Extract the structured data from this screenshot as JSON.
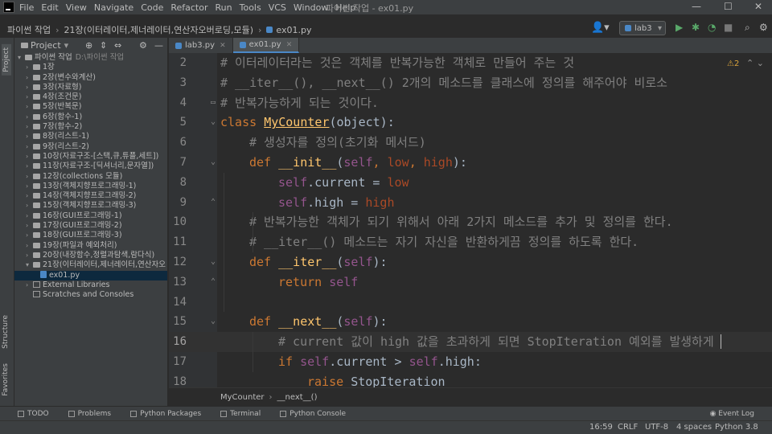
{
  "menubar": {
    "items": [
      "File",
      "Edit",
      "View",
      "Navigate",
      "Code",
      "Refactor",
      "Run",
      "Tools",
      "VCS",
      "Window",
      "Help"
    ],
    "window_title": "파이썬 작업 - ex01.py"
  },
  "navbar": {
    "project": "파이썬 작업",
    "folder": "21장(이터레이터,제너레이터,연산자오버로딩,모듈)",
    "file": "ex01.py",
    "run_config": "lab3"
  },
  "left_strip": {
    "project": "Project",
    "structure": "Structure",
    "favorites": "Favorites"
  },
  "project_panel": {
    "title": "Project",
    "root": "파이썬 작업",
    "root_path": "D:\\파이썬 작업",
    "folders": [
      "1장",
      "2장(변수와계산)",
      "3장(자료형)",
      "4장(조건문)",
      "5장(반복문)",
      "6장(함수-1)",
      "7장(함수-2)",
      "8장(리스트-1)",
      "9장(리스트-2)",
      "10장(자료구조-[스택,큐,튜플,세트])",
      "11장(자료구조-[딕셔너리,문자열])",
      "12장(collections 모듈)",
      "13장(객체지향프로그래밍-1)",
      "14장(객체지향프로그래밍-2)",
      "15장(객체지향프로그래밍-3)",
      "16장(GUI프로그래밍-1)",
      "17장(GUI프로그래밍-2)",
      "18장(GUI프로그래밍-3)",
      "19장(파일과 예외처리)",
      "20장(내장함수,정렬과탐색,람다식)",
      "21장(이터레이터,제너레이터,연산자오"
    ],
    "selected_file": "ex01.py",
    "external_libraries": "External Libraries",
    "scratches": "Scratches and Consoles"
  },
  "editor_tabs": [
    "lab3.py",
    "ex01.py"
  ],
  "editor": {
    "inspection_count": "2",
    "lines": [
      {
        "num": "2",
        "text": "# 이터레이터라는 것은 객체를 반복가능한 객체로 만들어 주는 것"
      },
      {
        "num": "3",
        "text": "# __iter__(), __next__() 2개의 메소드를 클래스에 정의를 해주어야 비로소"
      },
      {
        "num": "4",
        "text": "# 반복가능하게 되는 것이다."
      },
      {
        "num": "5",
        "kw": "class",
        "name": "MyCounter",
        "rest": "(object):"
      },
      {
        "num": "6",
        "text": "# 생성자를 정의(초기화 메서드)"
      },
      {
        "num": "7",
        "kw": "def",
        "fn": "__init__",
        "p_self": "self",
        "p1": "low",
        "p2": "high"
      },
      {
        "num": "8",
        "self": "self",
        "attr": ".current = ",
        "val": "low"
      },
      {
        "num": "9",
        "self": "self",
        "attr": ".high = ",
        "val": "high"
      },
      {
        "num": "10",
        "text": "# 반복가능한 객체가 되기 위해서 아래 2가지 메소드를 추가 및 정의를 한다."
      },
      {
        "num": "11",
        "text": "# __iter__() 메소드는 자기 자신을 반환하게끔 정의를 하도록 한다."
      },
      {
        "num": "12",
        "kw": "def",
        "fn": "__iter__",
        "p_self": "self"
      },
      {
        "num": "13",
        "kw": "return",
        "self": "self"
      },
      {
        "num": "14"
      },
      {
        "num": "15",
        "kw": "def",
        "fn": "__next__",
        "p_self": "self"
      },
      {
        "num": "16",
        "text": "# current 값이 high 값을 초과하게 되면 StopIteration 예외를 발생하게"
      },
      {
        "num": "17",
        "kw": "if",
        "self1": "self",
        "mid": ".current > ",
        "self2": "self",
        "end": ".high:"
      },
      {
        "num": "18",
        "kw": "raise",
        "exc": "StopIteration"
      }
    ]
  },
  "editor_breadcrumb": {
    "class": "MyCounter",
    "method": "__next__()"
  },
  "tool_windows": [
    "TODO",
    "Problems",
    "Python Packages",
    "Terminal",
    "Python Console"
  ],
  "event_log": "Event Log",
  "statusbar": {
    "position": "16:59",
    "line_sep": "CRLF",
    "encoding": "UTF-8",
    "indent": "4 spaces",
    "interpreter": "Python 3.8"
  }
}
